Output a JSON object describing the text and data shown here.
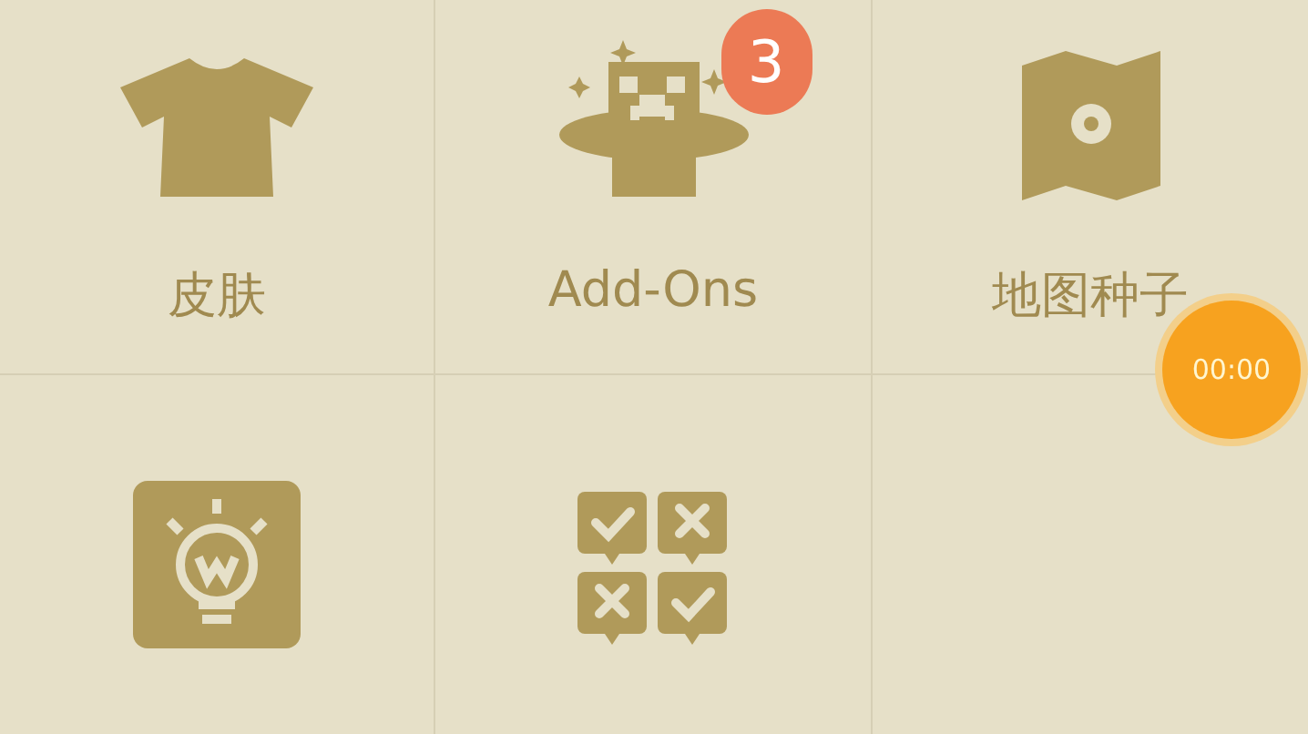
{
  "grid": {
    "items": [
      {
        "kind": "shirt",
        "label": "皮肤"
      },
      {
        "kind": "hat",
        "label": "Add-Ons",
        "badge": "3"
      },
      {
        "kind": "map",
        "label": "地图种子"
      },
      {
        "kind": "bulb"
      },
      {
        "kind": "votes"
      },
      {
        "kind": "empty"
      }
    ]
  },
  "floating_timer": {
    "label": "00:00"
  }
}
